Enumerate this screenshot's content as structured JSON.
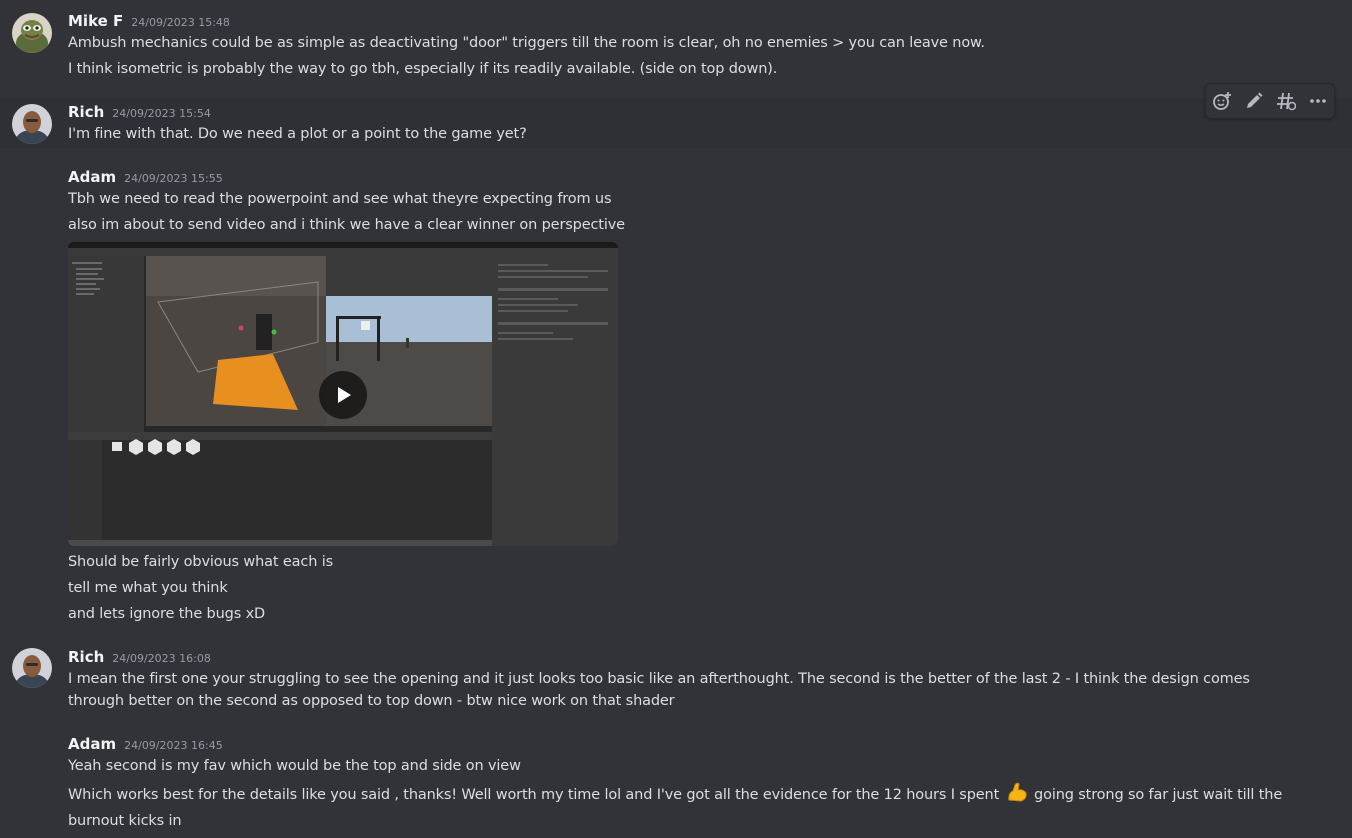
{
  "messages": [
    {
      "author": "Mike F",
      "timestamp": "24/09/2023 15:48",
      "lines": [
        "Ambush mechanics could be as simple as deactivating \"door\" triggers till the room is clear, oh no enemies > you can leave now.",
        "I think isometric is probably the way to go tbh, especially if its readily available. (side on top down)."
      ]
    },
    {
      "author": "Rich",
      "timestamp": "24/09/2023 15:54",
      "lines": [
        "I'm fine with that. Do we need a plot or a point to the game yet?"
      ]
    },
    {
      "author": "Adam",
      "timestamp": "24/09/2023 15:55",
      "lines": [
        "Tbh we need to read the powerpoint and see what theyre expecting from us",
        "also im about to send video and i think we have a clear winner on perspective"
      ],
      "after_video": [
        "Should be fairly obvious what each is",
        "tell me what you think",
        "and lets ignore the bugs xD"
      ]
    },
    {
      "author": "Rich",
      "timestamp": "24/09/2023 16:08",
      "lines": [
        "I mean the first one your struggling to see the opening and it just looks too basic like an afterthought. The second is the better of the last 2 - I think the design comes through better on the second as opposed to top down - btw nice work on that shader"
      ]
    },
    {
      "author": "Adam",
      "timestamp": "24/09/2023 16:45",
      "lines": [
        "Yeah second is my fav which would be the top and side on view",
        "Which works best for the details like you said , thanks! Well worth my time lol and I've got all the evidence for the 12 hours I spent",
        "going strong so far just wait till the burnout kicks in"
      ]
    }
  ],
  "toolbar": {
    "icons": [
      "add-reaction-icon",
      "edit-icon",
      "thread-icon",
      "more-icon"
    ]
  },
  "colors": {
    "background": "#313338",
    "hover": "#2e3035",
    "text": "#dbdee1",
    "author": "#f2f3f5",
    "timestamp": "#949ba4",
    "orange_floor": "#e8901f"
  }
}
